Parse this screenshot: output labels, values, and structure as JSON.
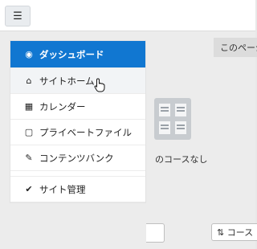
{
  "topbar": {
    "menu_icon": "☰"
  },
  "sidebar": {
    "items": [
      {
        "label": "ダッシュボード",
        "icon": "tachometer-icon",
        "glyph": "◉"
      },
      {
        "label": "サイトホーム",
        "icon": "home-icon",
        "glyph": "⌂"
      },
      {
        "label": "カレンダー",
        "icon": "calendar-icon",
        "glyph": "▦"
      },
      {
        "label": "プライベートファイル",
        "icon": "file-icon",
        "glyph": "▢"
      },
      {
        "label": "コンテンツバンク",
        "icon": "paintbrush-icon",
        "glyph": "✎"
      },
      {
        "label": "サイト管理",
        "icon": "wrench-icon",
        "glyph": "✔"
      }
    ]
  },
  "main": {
    "page_button": "このページ",
    "empty_text": "のコースなし",
    "course_button": "⇅ コース"
  },
  "colors": {
    "accent": "#1177d1"
  }
}
